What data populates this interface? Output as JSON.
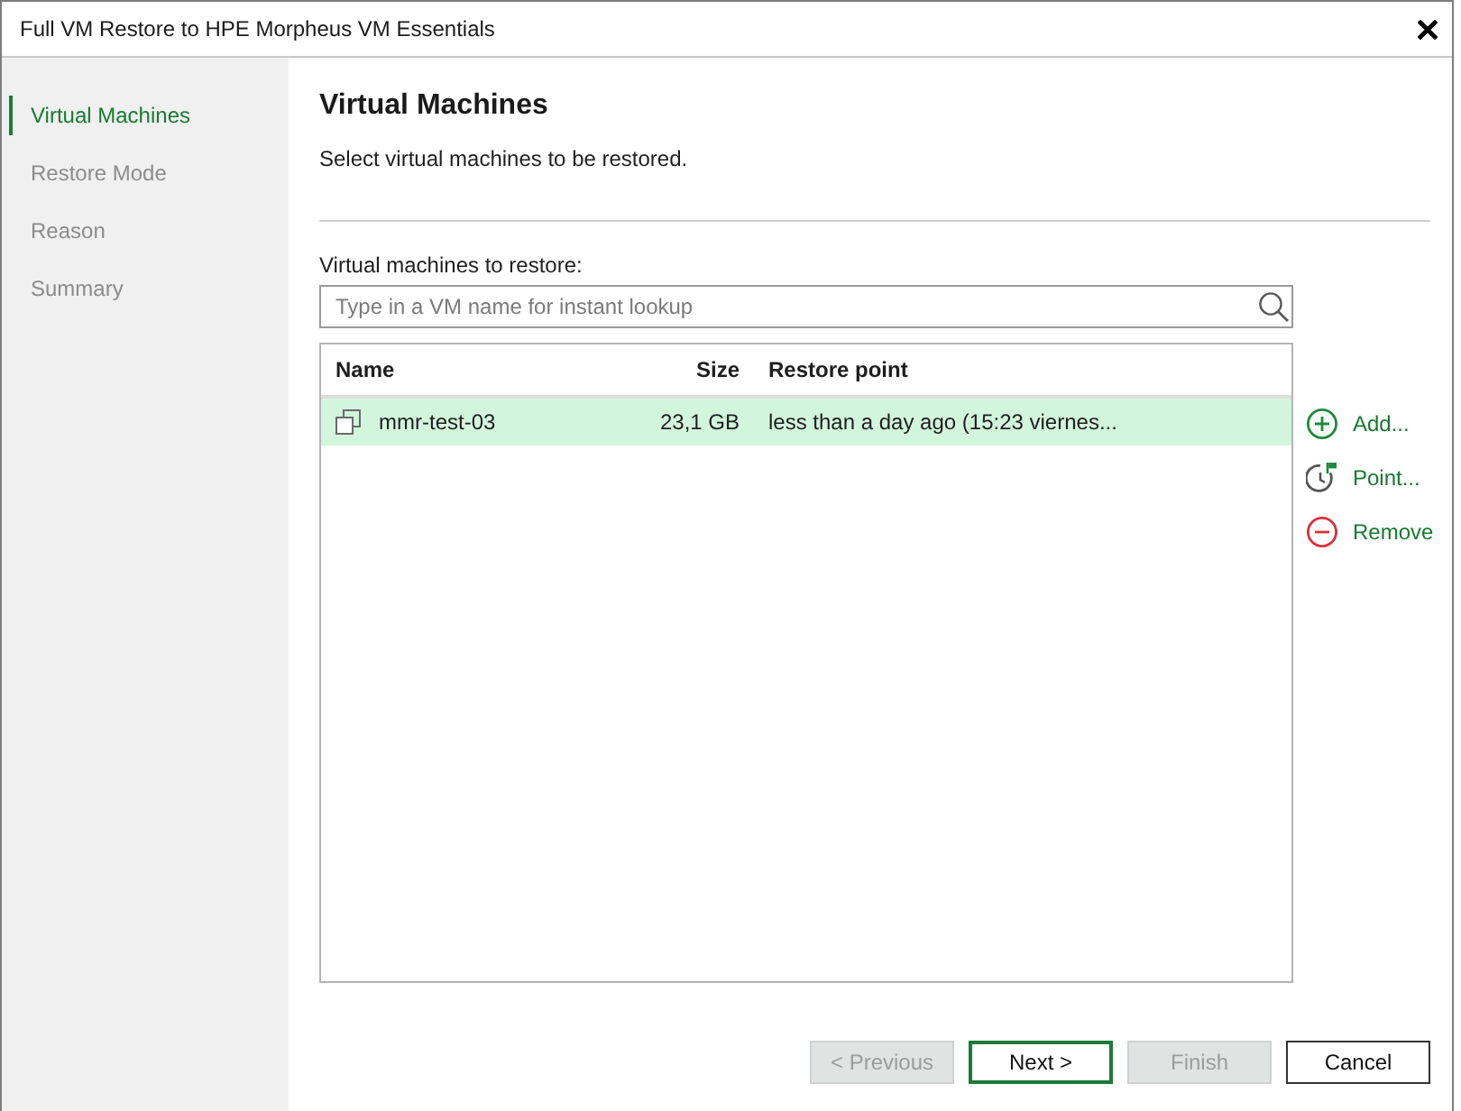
{
  "window": {
    "title": "Full VM Restore to HPE Morpheus VM Essentials"
  },
  "steps": [
    {
      "label": "Virtual Machines",
      "selected": true
    },
    {
      "label": "Restore Mode",
      "selected": false
    },
    {
      "label": "Reason",
      "selected": false
    },
    {
      "label": "Summary",
      "selected": false
    }
  ],
  "page": {
    "title": "Virtual Machines",
    "description": "Select virtual machines to be restored."
  },
  "vm_list": {
    "label": "Virtual machines to restore:",
    "search": {
      "placeholder": "Type in a VM name for instant lookup"
    },
    "columns": [
      "Name",
      "Size",
      "Restore point"
    ],
    "rows": [
      {
        "name": "mmr-test-03",
        "size": "23,1 GB",
        "restore_point": "less than a day ago (15:23 viernes...",
        "selected": true
      }
    ]
  },
  "actions": [
    {
      "kind": "add",
      "label": "Add..."
    },
    {
      "kind": "point",
      "label": "Point..."
    },
    {
      "kind": "remove",
      "label": "Remove"
    }
  ],
  "buttons": [
    {
      "label": "< Previous",
      "disabled": true,
      "default": false
    },
    {
      "label": "Next >",
      "disabled": false,
      "default": true
    },
    {
      "label": "Finish",
      "disabled": true,
      "default": false
    },
    {
      "label": "Cancel",
      "disabled": false,
      "default": false
    }
  ]
}
